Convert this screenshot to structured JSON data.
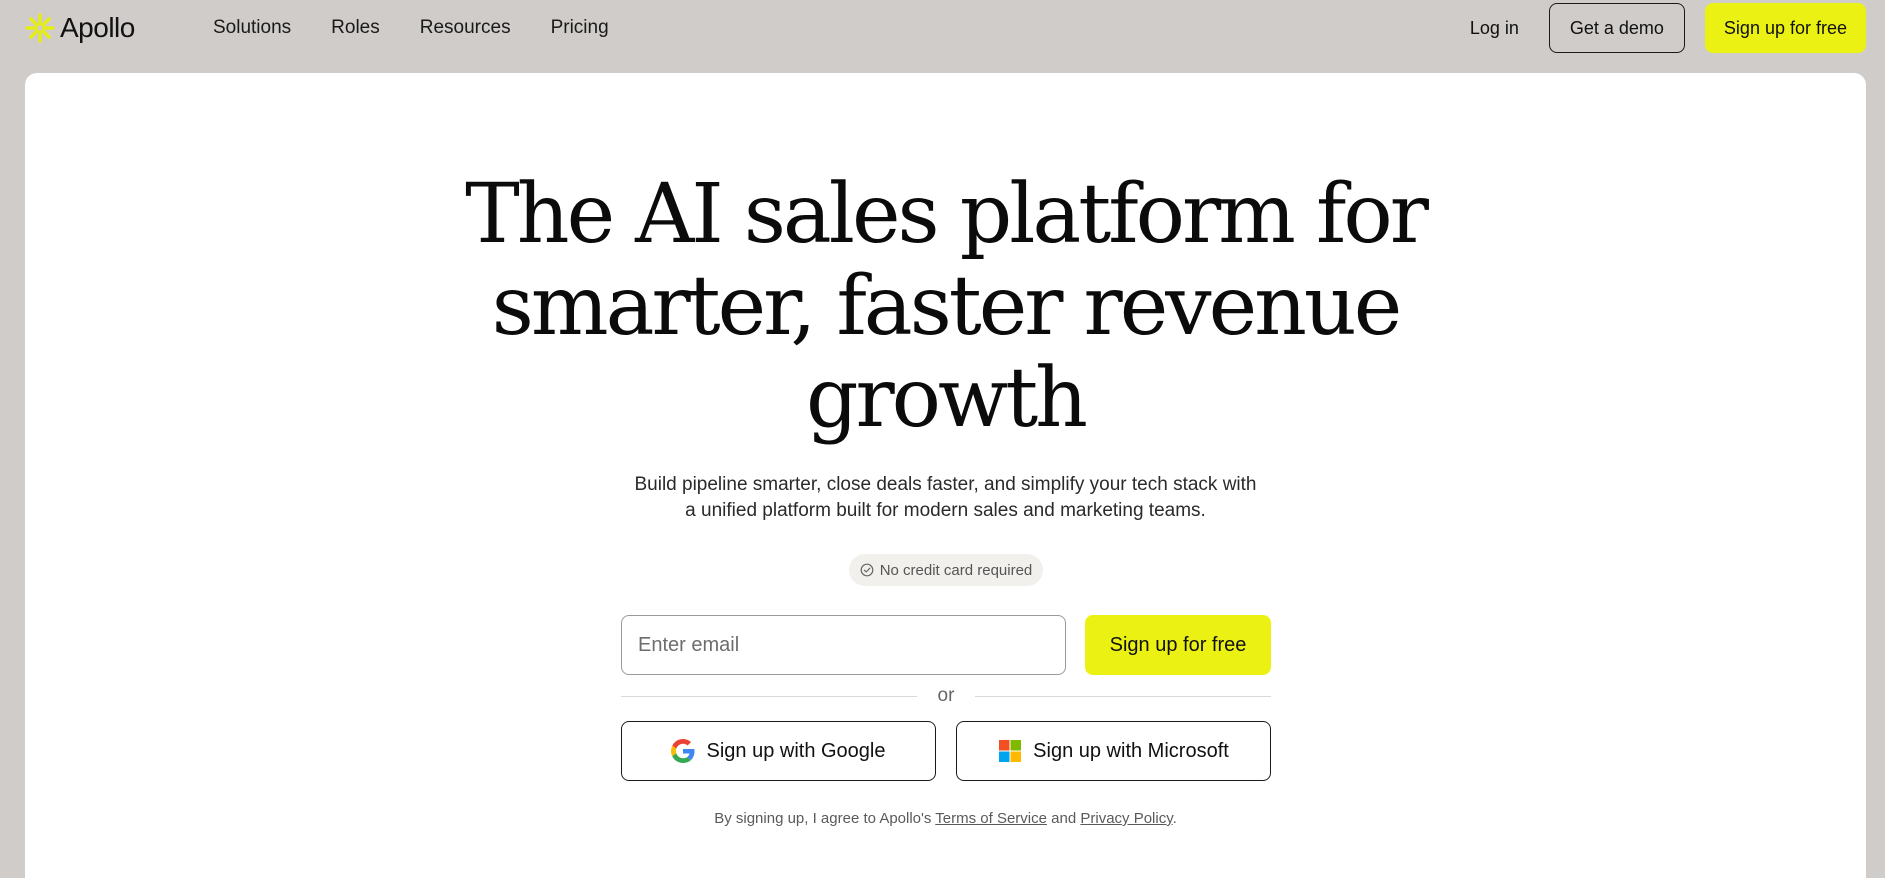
{
  "brand": {
    "name": "Apollo",
    "icon": "apollo-burst-icon",
    "accent": "#ebf213"
  },
  "nav": {
    "items": [
      {
        "label": "Solutions"
      },
      {
        "label": "Roles"
      },
      {
        "label": "Resources"
      },
      {
        "label": "Pricing"
      }
    ]
  },
  "header_actions": {
    "login": "Log in",
    "demo": "Get a demo",
    "signup": "Sign up for free"
  },
  "hero": {
    "title_lines": [
      "The AI sales platform for",
      "smarter, faster revenue",
      "growth"
    ],
    "subtitle_lines": [
      "Build pipeline smarter, close deals faster, and simplify your tech stack with",
      "a unified platform built for modern sales and marketing teams."
    ],
    "badge": {
      "icon": "check-circle-icon",
      "text": "No credit card required"
    }
  },
  "signup_form": {
    "email_placeholder": "Enter email",
    "email_value": "",
    "submit_label": "Sign up for free",
    "divider_text": "or",
    "google_label": "Sign up with Google",
    "google_icon": "google-icon",
    "microsoft_label": "Sign up with Microsoft",
    "microsoft_icon": "microsoft-icon"
  },
  "legal": {
    "prefix": "By signing up, I agree to Apollo's ",
    "terms": "Terms of Service",
    "middle": " and ",
    "privacy": "Privacy Policy",
    "suffix": "."
  },
  "colors": {
    "page_bg": "#d0ccc9",
    "card_bg": "#ffffff",
    "cta": "#ebf213"
  }
}
